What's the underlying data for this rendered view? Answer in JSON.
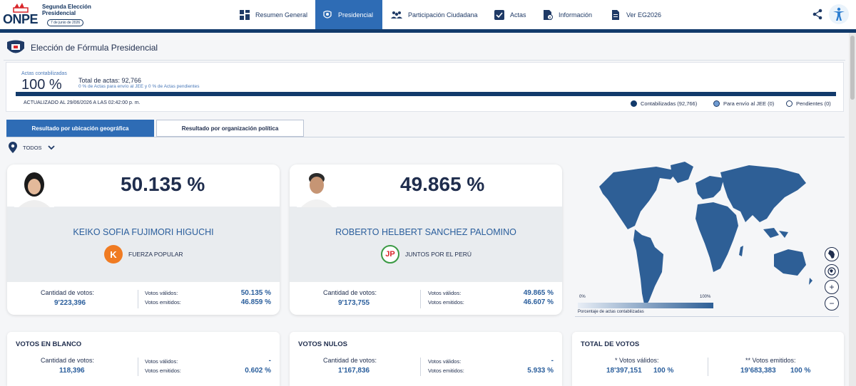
{
  "header": {
    "logo_text": "ONPE",
    "election_title": "Segunda Elección Presidencial",
    "election_date": "7 de junio de 2026",
    "nav": [
      {
        "label": "Resumen General",
        "icon": "dashboard-icon"
      },
      {
        "label": "Presidencial",
        "icon": "seal-icon"
      },
      {
        "label": "Participación Ciudadana",
        "icon": "people-icon"
      },
      {
        "label": "Actas",
        "icon": "checklist-icon"
      },
      {
        "label": "Información",
        "icon": "info-doc-icon"
      },
      {
        "label": "Ver EG2026",
        "icon": "document-icon"
      }
    ],
    "active_nav": "Presidencial"
  },
  "page": {
    "title": "Elección de Fórmula Presidencial"
  },
  "summary": {
    "actas_label": "Actas contabilizadas",
    "actas_pct": "100 %",
    "actas_fraction": 1.0,
    "total_actas": "Total de actas: 92,766",
    "note": "0 % de Actas para envío al JEE y 0 % de Actas pendientes",
    "updated": "ACTUALIZADO AL 29/06/2026 A LAS 02:42:00 p. m.",
    "legend": [
      {
        "label": "Contabilizadas (92,766)",
        "color": "#123a6b"
      },
      {
        "label": "Para envío al JEE (0)",
        "color": "#6f9bd1"
      },
      {
        "label": "Pendientes (0)",
        "color": "#ffffff"
      }
    ]
  },
  "tabs": {
    "geo": "Resultado por ubicación geográfica",
    "org": "Resultado por organización política"
  },
  "filter": {
    "label": "TODOS"
  },
  "candidates": [
    {
      "pct": "50.135 %",
      "name": "KEIKO SOFIA FUJIMORI HIGUCHI",
      "party": "FUERZA POPULAR",
      "party_logo": "K",
      "party_color": "#f07b22",
      "votes_label": "Cantidad de votos:",
      "votes": "9'223,396",
      "valid_label": "Votos válidos:",
      "valid_pct": "50.135 %",
      "emitted_label": "Votos emitidos:",
      "emitted_pct": "46.859 %"
    },
    {
      "pct": "49.865 %",
      "name": "ROBERTO HELBERT SANCHEZ PALOMINO",
      "party": "JUNTOS POR EL PERÚ",
      "party_logo": "JP",
      "party_color": "#d9262b",
      "votes_label": "Cantidad de votos:",
      "votes": "9'173,755",
      "valid_label": "Votos válidos:",
      "valid_pct": "49.865 %",
      "emitted_label": "Votos emitidos:",
      "emitted_pct": "46.607 %"
    }
  ],
  "map": {
    "legend_min": "0%",
    "legend_max": "100%",
    "caption": "Porcentaje de actas contabilizadas",
    "fill_color": "#2e5f96"
  },
  "bottom": {
    "blank": {
      "title": "VOTOS EN BLANCO",
      "votes_label": "Cantidad de votos:",
      "votes": "118,396",
      "valid_label": "Votos válidos:",
      "valid_pct": "-",
      "emitted_label": "Votos emitidos:",
      "emitted_pct": "0.602 %"
    },
    "null": {
      "title": "VOTOS NULOS",
      "votes_label": "Cantidad de votos:",
      "votes": "1'167,836",
      "valid_label": "Votos válidos:",
      "valid_pct": "-",
      "emitted_label": "Votos emitidos:",
      "emitted_pct": "5.933 %"
    },
    "total": {
      "title": "TOTAL DE VOTOS",
      "valid_label": "* Votos válidos:",
      "valid_votes": "18'397,151",
      "valid_pct": "100 %",
      "emitted_label": "** Votos emitidos:",
      "emitted_votes": "19'683,383",
      "emitted_pct": "100 %"
    }
  }
}
